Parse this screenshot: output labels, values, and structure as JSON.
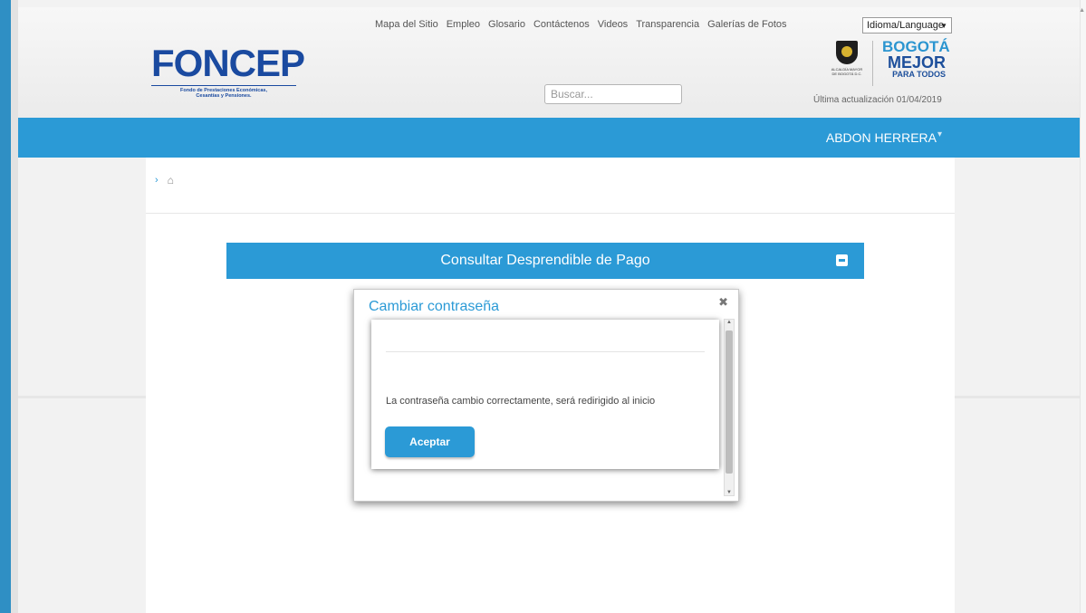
{
  "header": {
    "top_links": [
      "Mapa del Sitio",
      "Empleo",
      "Glosario",
      "Contáctenos",
      "Videos",
      "Transparencia",
      "Galerías de Fotos"
    ],
    "language_select": "Idioma/Language",
    "logo": {
      "word": "FONCEP",
      "subtitle_line1": "Fondo de Prestaciones Económicas,",
      "subtitle_line2": "Cesantías y Pensiones."
    },
    "search": {
      "placeholder": "Buscar..."
    },
    "seal_text_1": "ALCALDÍA MAYOR",
    "seal_text_2": "DE BOGOTÁ D.C.",
    "bogota_1": "BOGOTÁ",
    "bogota_2": "MEJOR",
    "bogota_3": "PARA TODOS",
    "last_update": "Última actualización 01/04/2019"
  },
  "navbar": {
    "user_name": "ABDON HERRERA"
  },
  "breadcrumb": {
    "chevron": "›"
  },
  "panel": {
    "title": "Consultar Desprendible de Pago"
  },
  "dialog": {
    "title": "Cambiar contraseña",
    "message": "La contraseña cambio correctamente, será redirigido al inicio",
    "accept_label": "Aceptar"
  },
  "colors": {
    "accent": "#2b9ad6",
    "logo_blue": "#1a4aa0"
  }
}
